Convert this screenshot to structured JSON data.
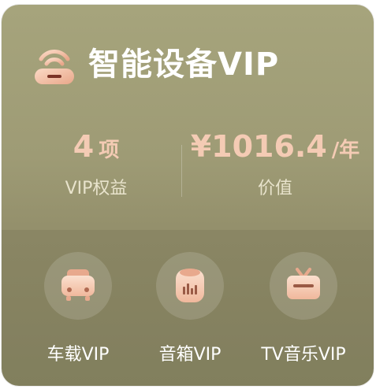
{
  "card": {
    "title": "智能设备VIP",
    "icon": "router-icon"
  },
  "stats": {
    "benefits": {
      "value": "4",
      "unit": "项",
      "label": "VIP权益"
    },
    "worth": {
      "value": "¥1016.4",
      "unit": "/年",
      "label": "价值"
    }
  },
  "features": [
    {
      "label": "车载VIP",
      "icon": "car-icon"
    },
    {
      "label": "音箱VIP",
      "icon": "speaker-icon"
    },
    {
      "label": "TV音乐VIP",
      "icon": "tv-icon"
    }
  ],
  "colors": {
    "card_bg": "#9e9b75",
    "accent": "#f4cbb4",
    "title": "#ffffff"
  }
}
